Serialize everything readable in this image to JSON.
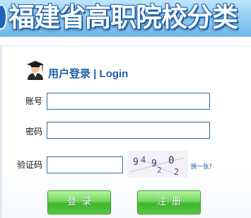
{
  "banner": {
    "title": "福建省高职院校分类"
  },
  "login": {
    "title": "用户登录 | Login",
    "username_label": "账号",
    "username_value": "",
    "password_label": "密码",
    "password_value": "",
    "captcha_label": "验证码",
    "captcha_value": "",
    "captcha_chars": [
      "9",
      "4",
      "9",
      "2",
      "0",
      "2"
    ],
    "refresh_label": "换一张?",
    "login_button": "登录",
    "register_button": "注册"
  }
}
